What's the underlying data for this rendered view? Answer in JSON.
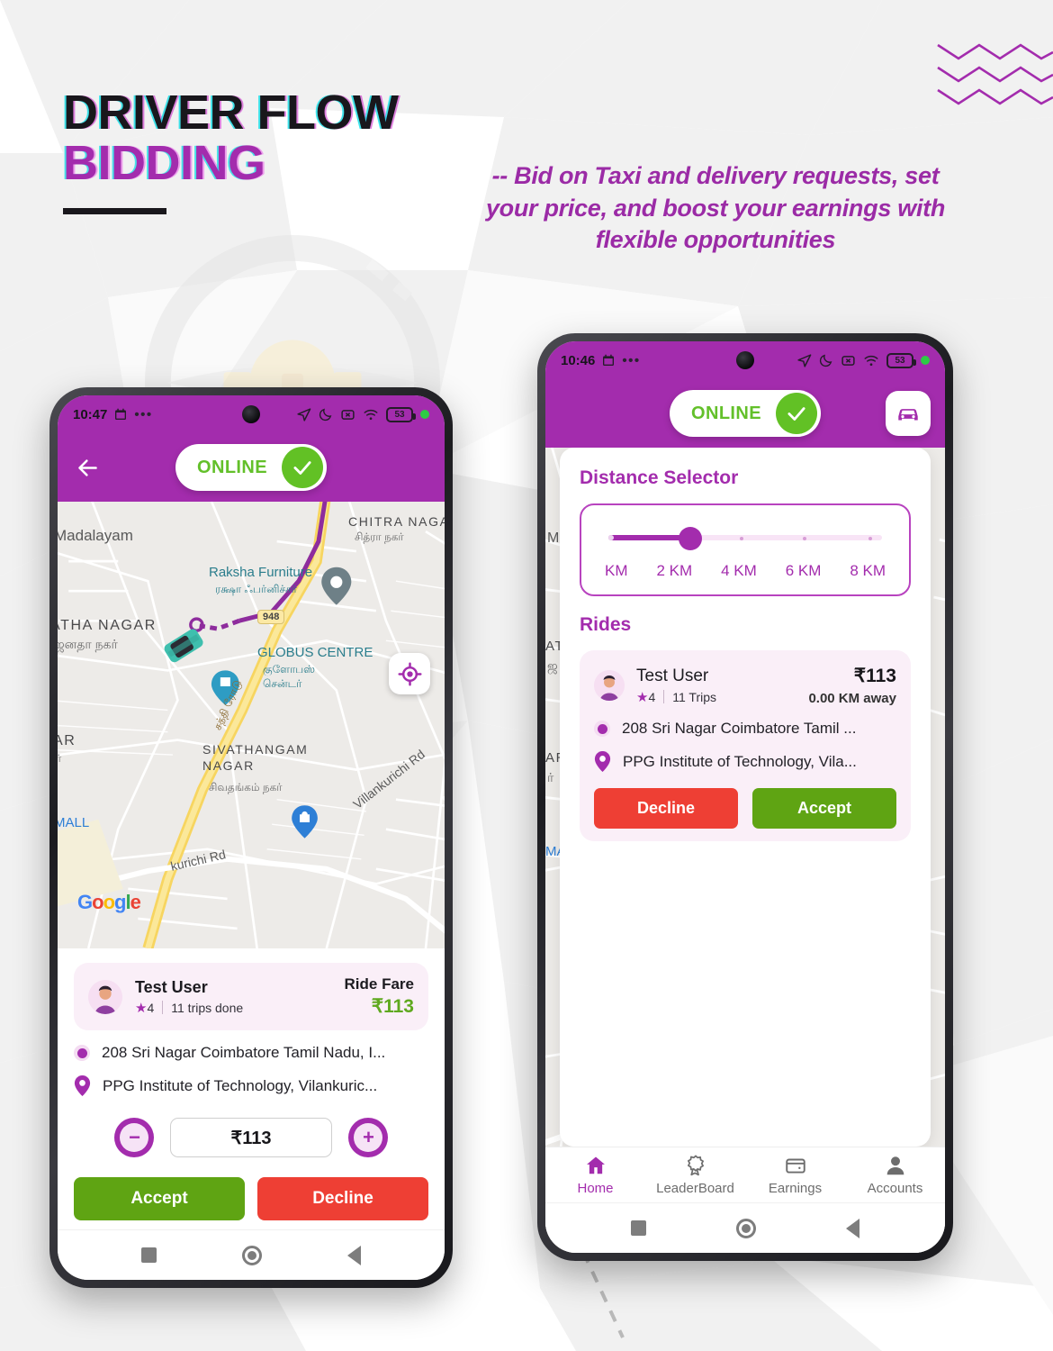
{
  "poster": {
    "title_line1": "DRIVER FLOW",
    "title_line2": "BIDDING",
    "subtitle": "-- Bid on Taxi and delivery  requests, set your price, and boost your earnings with flexible opportunities",
    "accent_color": "#A32CAD",
    "green_color": "#5FA413",
    "red_color": "#EE3F34"
  },
  "left_phone": {
    "status": {
      "time": "10:47",
      "battery": "53",
      "icons": [
        "calendar-icon",
        "more-icon",
        "location-arrow-icon",
        "moon-icon",
        "x-box-icon",
        "wifi-icon",
        "battery-icon",
        "green-dot-icon"
      ]
    },
    "appbar": {
      "back_icon": "back-arrow-icon",
      "online_label": "ONLINE",
      "check_icon": "check-icon"
    },
    "map": {
      "labels": [
        "Madalayam",
        "CHITRA NAGAR",
        "சித்ரா நகர்",
        "Raksha Furniture",
        "ரக்ஷா ஃபர்னிச்சர்",
        "ATHA NAGAR",
        "ஜனதா நகர்",
        "GLOBUS CENTRE",
        "குளோபஸ் சென்டர்",
        "SIVATHANGAM NAGAR",
        "சிவதங்கம் நகர்",
        "AR",
        "ர்",
        "MALL",
        "Villankurichi Rd",
        "kurichi Rd",
        "சத்தி ரோடு"
      ],
      "highway_shield": "948",
      "attribution": "Google",
      "locate_icon": "my-location-icon"
    },
    "ride": {
      "name": "Test User",
      "rating": "4",
      "trips": "11 trips done",
      "fare_label": "Ride Fare",
      "fare": "₹113",
      "pickup": "208 Sri Nagar Coimbatore Tamil Nadu, I...",
      "dropoff": "PPG Institute of Technology, Vilankuric...",
      "bid_value": "₹113",
      "minus_label": "−",
      "plus_label": "+",
      "accept_label": "Accept",
      "decline_label": "Decline"
    },
    "androidnav": [
      "recents-square-icon",
      "home-circle-icon",
      "back-triangle-icon"
    ]
  },
  "right_phone": {
    "status": {
      "time": "10:46",
      "battery": "53"
    },
    "appbar": {
      "online_label": "ONLINE",
      "check_icon": "check-icon",
      "car_icon": "car-icon"
    },
    "distance": {
      "title": "Distance Selector",
      "options": [
        "KM",
        "2 KM",
        "4 KM",
        "6 KM",
        "8 KM"
      ],
      "selected": "2 KM"
    },
    "rides": {
      "title": "Rides",
      "name": "Test User",
      "rating": "4",
      "trips": "11 Trips",
      "fare": "₹113",
      "away": "0.00 KM away",
      "pickup": "208 Sri Nagar Coimbatore Tamil ...",
      "dropoff": "PPG Institute of Technology, Vila...",
      "decline_label": "Decline",
      "accept_label": "Accept"
    },
    "tabs": [
      {
        "label": "Home",
        "icon": "home-icon",
        "active": true
      },
      {
        "label": "LeaderBoard",
        "icon": "badge-icon",
        "active": false
      },
      {
        "label": "Earnings",
        "icon": "wallet-icon",
        "active": false
      },
      {
        "label": "Accounts",
        "icon": "person-icon",
        "active": false
      }
    ]
  }
}
